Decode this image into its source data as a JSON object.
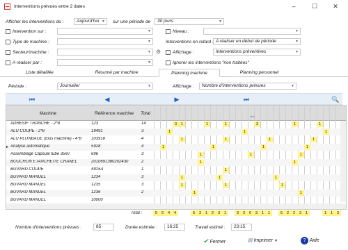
{
  "window": {
    "title": "Interventions prévues entre 2 dates",
    "minimize": "–",
    "maximize": "☐",
    "close": "✕"
  },
  "filters": {
    "afficher_label": "Afficher les interventions du :",
    "afficher_value": "Aujourd'hui",
    "periode_label": "sur une période de",
    "periode_value": "30 jours",
    "intervention_label": "Intervention sur :",
    "type_label": "Type de machine :",
    "secteur_label": "Secteur/machine :",
    "realiser_label": "A réaliser par :",
    "niveau_label": "Niveau :",
    "retard_label": "Interventions en retard :",
    "retard_value": "A réaliser en début de période",
    "affichage_label": "Affichage :",
    "affichage_value": "Interventions préventives",
    "ignorer_label": "Ignorer les interventions \"non traitées\""
  },
  "tabs": [
    "Liste détaillée",
    "Résumé par machine",
    "Planning machine",
    "Planning personnel"
  ],
  "active_tab": "Planning machine",
  "planning": {
    "periode_label": "Période :",
    "periode_value": "Journalier",
    "affichage_label": "Affichage :",
    "affichage_value": "Nombre d'interventions prévues"
  },
  "grid": {
    "headers": {
      "machine": "Machine",
      "reference": "Référence machine",
      "total": "Total"
    },
    "day_marker": "Nov",
    "rows": [
      {
        "machine": "ADHESIF TRANCHE - 2*8",
        "ref": "123",
        "total": "14",
        "marks": [
          [
            3,
            "3"
          ],
          [
            4,
            "1"
          ],
          [
            8,
            "1"
          ],
          [
            11,
            "1"
          ],
          [
            16,
            "3"
          ],
          [
            22,
            "1"
          ],
          [
            26,
            "1"
          ]
        ]
      },
      {
        "machine": "ALU COUPE - 2*8",
        "ref": "19491",
        "total": "3",
        "marks": [
          [
            2,
            "1"
          ],
          [
            14,
            "1"
          ],
          [
            27,
            "1"
          ]
        ]
      },
      {
        "machine": "ALU PLONBAGE (tous machine) - 4*8",
        "ref": "103918",
        "total": "4",
        "marks": [
          [
            4,
            "1"
          ],
          [
            11,
            "1"
          ],
          [
            18,
            "1"
          ],
          [
            25,
            "1"
          ]
        ]
      },
      {
        "machine": "Analyse automatique",
        "ref": "5928",
        "total": "4",
        "marks": [
          [
            1,
            "1"
          ],
          [
            9,
            "1"
          ],
          [
            17,
            "1"
          ],
          [
            24,
            "1"
          ]
        ],
        "current": true
      },
      {
        "machine": "Assemblage Capsule tube 35ml",
        "ref": "696",
        "total": "3",
        "marks": [
          [
            7,
            "1"
          ],
          [
            15,
            "1"
          ],
          [
            23,
            "1"
          ]
        ]
      },
      {
        "machine": "BOUCHON ETANCHEITE CHANEL",
        "ref": "2010691380202430",
        "total": "2",
        "marks": [
          [
            7,
            "1"
          ],
          [
            22,
            "1"
          ]
        ]
      },
      {
        "machine": "BUVARD COUPE",
        "ref": "4915A",
        "total": "1",
        "marks": [
          [
            11,
            "1"
          ]
        ]
      },
      {
        "machine": "BUVARD MANUEL",
        "ref": "1234",
        "total": "3",
        "marks": [
          [
            4,
            "1"
          ],
          [
            10,
            "1"
          ],
          [
            19,
            "1"
          ]
        ]
      },
      {
        "machine": "BUVARD MANUEL",
        "ref": "1235",
        "total": "3",
        "marks": [
          [
            4,
            "1"
          ],
          [
            11,
            "1"
          ],
          [
            20,
            "1"
          ]
        ]
      },
      {
        "machine": "BUVARD MANUEL",
        "ref": "1236",
        "total": "2",
        "marks": [
          [
            6,
            "1"
          ],
          [
            23,
            "1"
          ]
        ]
      },
      {
        "machine": "BUVARD MANUEL",
        "ref": "10000",
        "total": "",
        "marks": []
      }
    ],
    "total_label": "Total :",
    "totals": [
      "5",
      "6",
      "4",
      "4",
      "",
      "",
      "6",
      "3",
      "1",
      "2",
      "3",
      "1",
      "",
      "3",
      "3",
      "6",
      "3",
      "1",
      "1",
      "",
      "5",
      "2",
      "2",
      "3",
      "1",
      "",
      "",
      "1",
      "1",
      "3"
    ]
  },
  "footer": {
    "nombre_label": "Nombre d'interventions prévues :",
    "nombre_value": "85",
    "duree_label": "Durée estimée :",
    "duree_value": "16:25",
    "travail_label": "Travail estimé :",
    "travail_value": "23:15",
    "fermer": "Fermer",
    "imprimer": "Imprimer",
    "aide": "Aide"
  }
}
